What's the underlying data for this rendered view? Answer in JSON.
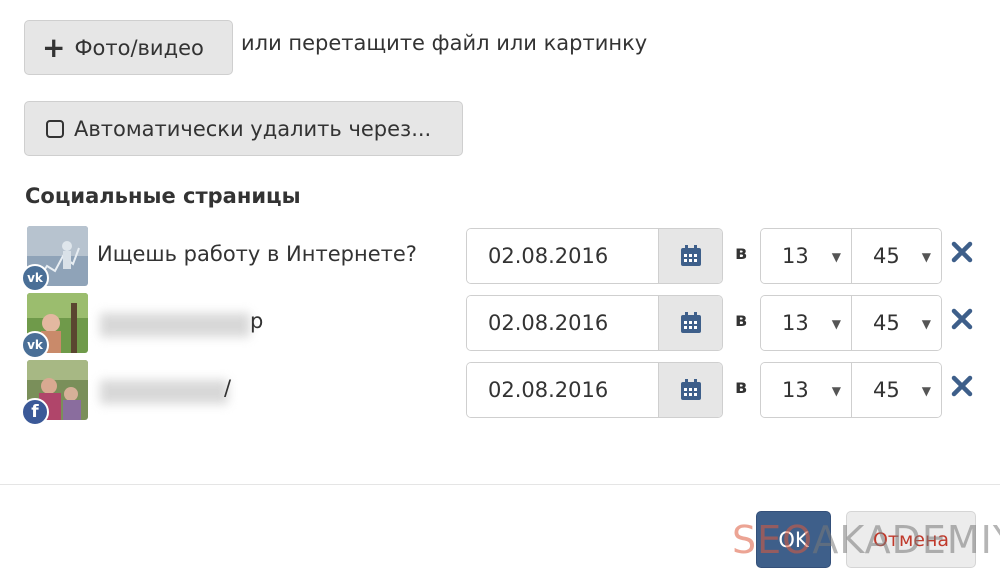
{
  "upload": {
    "photo_label": "Фото/видео",
    "drop_text": "или перетащите файл или картинку"
  },
  "auto_delete": {
    "label": "Автоматически удалить через..."
  },
  "social": {
    "title": "Социальные страницы",
    "at_label": "в",
    "rows": [
      {
        "network": "vk",
        "network_icon": "vk-icon",
        "name": "Ищешь работу в Интернете?",
        "date": "02.08.2016",
        "hour": "13",
        "minute": "45"
      },
      {
        "network": "vk",
        "network_icon": "vk-icon",
        "name": "",
        "name_tail": "р",
        "date": "02.08.2016",
        "hour": "13",
        "minute": "45"
      },
      {
        "network": "facebook",
        "network_icon": "facebook-icon",
        "name": "",
        "name_tail": "/",
        "date": "02.08.2016",
        "hour": "13",
        "minute": "45"
      }
    ]
  },
  "footer": {
    "ok_label": "OK",
    "cancel_label": "Отмена"
  },
  "watermark": {
    "part1": "SEO",
    "part2": "AKADEMIYA"
  },
  "colors": {
    "primary": "#3e5f8a",
    "icon_blue": "#3e5f8a",
    "vk": "#4a6f97",
    "facebook": "#3b5998",
    "cancel_text": "#c0392b"
  },
  "icons": {
    "plus": "plus-icon",
    "checkbox": "checkbox-icon",
    "calendar": "calendar-icon",
    "remove": "close-icon",
    "caret": "chevron-down-icon"
  }
}
